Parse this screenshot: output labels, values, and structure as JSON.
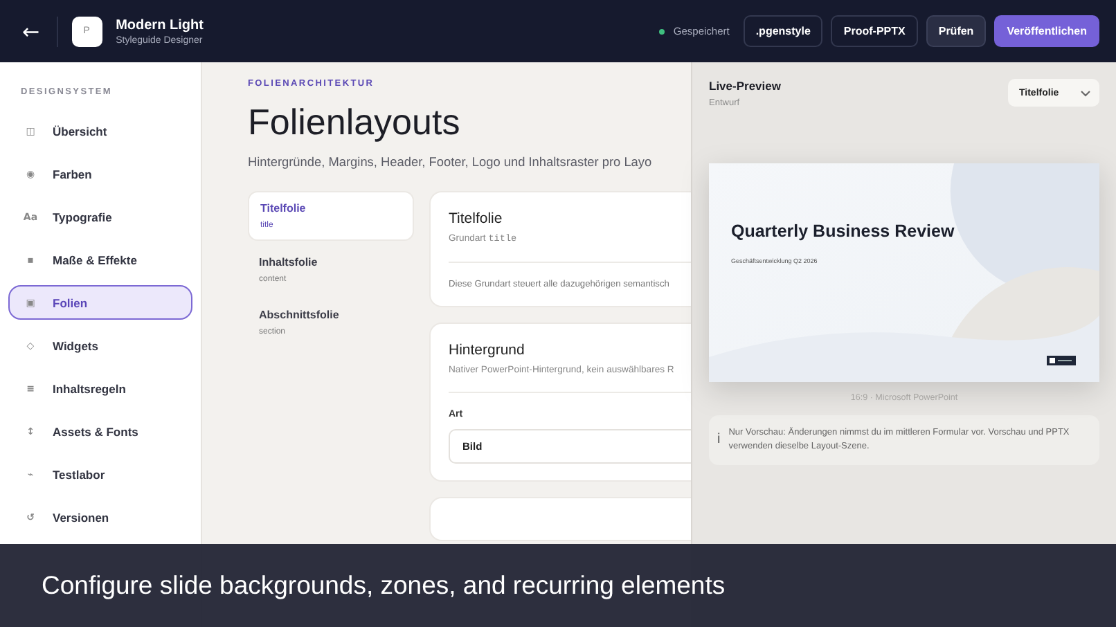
{
  "header": {
    "back_icon": "←",
    "logo_letter": "P",
    "title": "Modern Light",
    "subtitle": "Styleguide Designer",
    "status": {
      "label": "Gespeichert",
      "color": "#3fbf7f"
    },
    "buttons": [
      {
        "label": ".pgenstyle",
        "kind": "outline"
      },
      {
        "label": "Proof-PPTX",
        "kind": "outline"
      },
      {
        "label": "Prüfen",
        "kind": "muted"
      },
      {
        "label": "Veröffentlichen",
        "kind": "primary"
      }
    ]
  },
  "sidebar": {
    "heading": "DESIGNSYSTEM",
    "items": [
      {
        "icon": "◫",
        "label": "Übersicht",
        "selected": false
      },
      {
        "icon": "◉",
        "label": "Farben",
        "selected": false
      },
      {
        "icon": "Aa",
        "label": "Typografie",
        "selected": false
      },
      {
        "icon": "▪",
        "label": "Maße & Effekte",
        "selected": false
      },
      {
        "icon": "▣",
        "label": "Folien",
        "selected": true
      },
      {
        "icon": "◇",
        "label": "Widgets",
        "selected": false
      },
      {
        "icon": "≡",
        "label": "Inhaltsregeln",
        "selected": false
      },
      {
        "icon": "↕",
        "label": "Assets & Fonts",
        "selected": false
      },
      {
        "icon": "⌁",
        "label": "Testlabor",
        "selected": false
      },
      {
        "icon": "↺",
        "label": "Versionen",
        "selected": false
      }
    ]
  },
  "main": {
    "eyebrow": "FOLIENARCHITEKTUR",
    "title": "Folienlayouts",
    "description": "Hintergründe, Margins, Header, Footer, Logo und Inhaltsraster pro Layo",
    "layouts": [
      {
        "name": "Titelfolie",
        "key": "title",
        "selected": true
      },
      {
        "name": "Inhaltsfolie",
        "key": "content",
        "selected": false
      },
      {
        "name": "Abschnittsfolie",
        "key": "section",
        "selected": false
      }
    ],
    "layout_card": {
      "title": "Titelfolie",
      "base_label": "Grundart",
      "base_code": "title",
      "note": "Diese Grundart steuert alle dazugehörigen semantisch"
    },
    "background_card": {
      "title": "Hintergrund",
      "hint": "Nativer PowerPoint-Hintergrund, kein auswählbares R",
      "field_label": "Art",
      "field_value": "Bild"
    }
  },
  "preview": {
    "title": "Live-Preview",
    "status": "Entwurf",
    "layout_select": "Titelfolie",
    "slide_title": "Quarterly Business Review",
    "slide_subtitle": "Geschäftsentwicklung Q2 2026",
    "format": "16:9 · Microsoft PowerPoint",
    "info_icon": "i",
    "info": "Nur Vorschau: Änderungen nimmst du im mittleren Formular vor. Vorschau und PPTX verwenden dieselbe Layout-Szene."
  },
  "caption": "Configure slide backgrounds, zones, and recurring elements"
}
